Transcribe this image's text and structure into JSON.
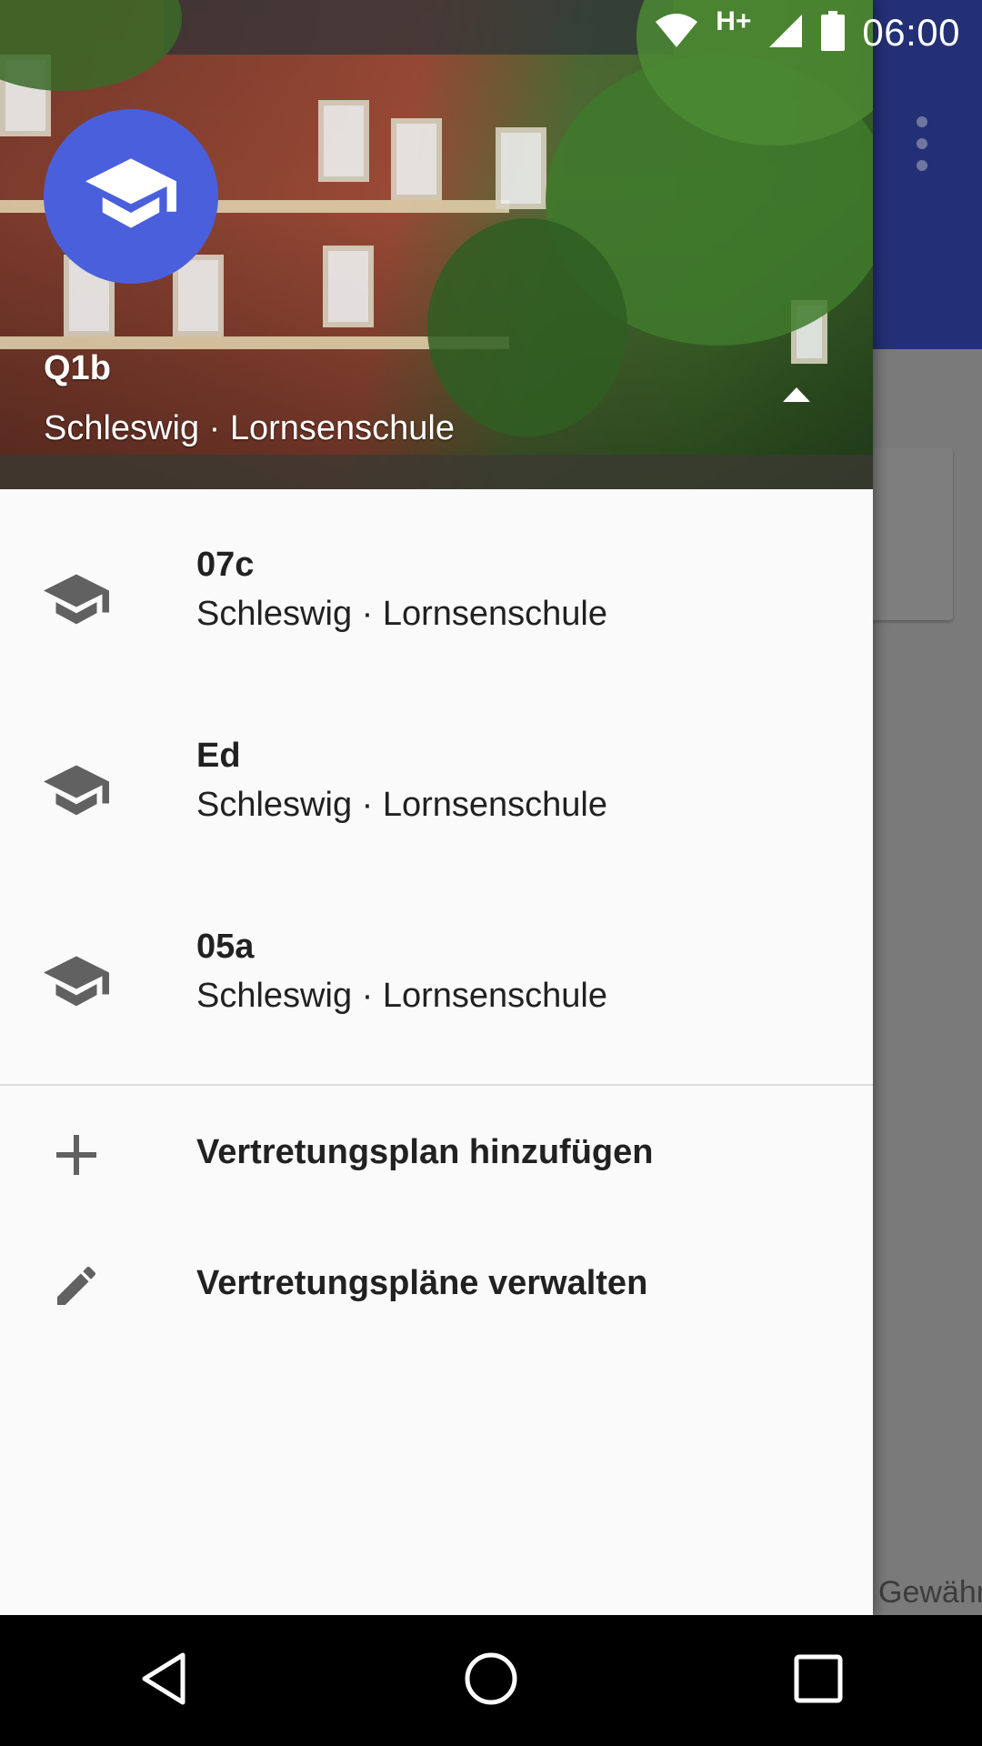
{
  "status_bar": {
    "network_type": "H+",
    "battery_level": "100",
    "time": "06:00"
  },
  "background": {
    "footer_text": "Gewähr."
  },
  "drawer": {
    "header": {
      "title": "Q1b",
      "subtitle": "Schleswig · Lornsenschule"
    },
    "plans": [
      {
        "title": "07c",
        "subtitle": "Schleswig · Lornsenschule",
        "icon": "school-icon"
      },
      {
        "title": "Ed",
        "subtitle": "Schleswig · Lornsenschule",
        "icon": "school-icon"
      },
      {
        "title": "05a",
        "subtitle": "Schleswig · Lornsenschule",
        "icon": "school-icon"
      }
    ],
    "actions": {
      "add_label": "Vertretungsplan hinzufügen",
      "manage_label": "Vertretungspläne verwalten"
    }
  },
  "colors": {
    "avatar": "#4a5fdc",
    "toolbar": "#243075",
    "drawer_bg": "#fafafa",
    "text_primary": "#212121",
    "icon_grey": "#616161"
  }
}
